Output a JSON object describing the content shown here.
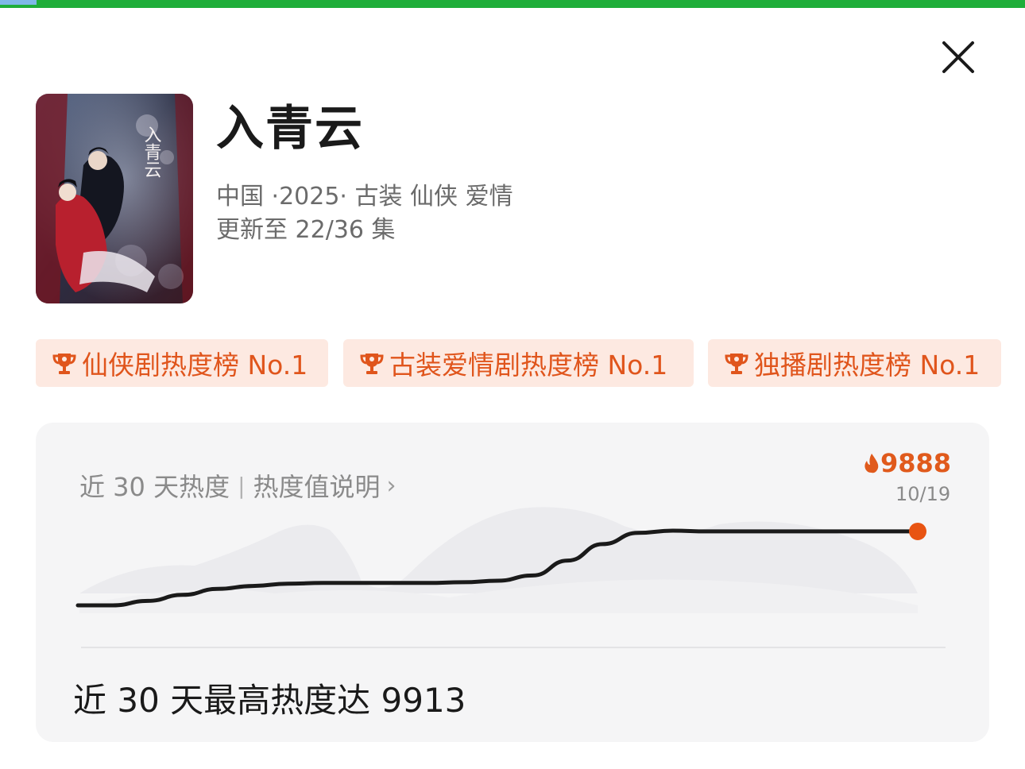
{
  "show": {
    "title": "入青云",
    "meta": "中国 ·2025· 古装 仙侠 爱情",
    "episodes": "更新至 22/36 集",
    "poster_title": "入青云"
  },
  "badges": [
    {
      "label": "仙侠剧热度榜 No.1",
      "icon": "trophy-icon"
    },
    {
      "label": "古装爱情剧热度榜 No.1",
      "icon": "trophy-icon"
    },
    {
      "label": "独播剧热度榜 No.1",
      "icon": "trophy-icon"
    }
  ],
  "heat": {
    "period_label": "近 30 天热度",
    "separator": "|",
    "explain_link": "热度值说明",
    "current_value": "9888",
    "current_date": "10/19",
    "summary": "近 30 天最高热度达 9913",
    "icons": {
      "flame": "flame-icon",
      "chevron": "chevron-right-icon",
      "close": "close-icon"
    }
  },
  "colors": {
    "accent": "#e05a1c",
    "badge_bg": "#fde9e1",
    "card_bg": "#f5f5f6",
    "line": "#1a1a1a",
    "top_bar": "#1fae3a"
  },
  "chart_data": {
    "type": "line",
    "x_range": "近 30 天",
    "end_label": "10/19",
    "end_value": 9888,
    "max_value": 9913,
    "y_relative": [
      0.0,
      0.0,
      0.06,
      0.14,
      0.22,
      0.26,
      0.29,
      0.3,
      0.3,
      0.3,
      0.3,
      0.31,
      0.33,
      0.4,
      0.6,
      0.82,
      0.97,
      1.0,
      0.99,
      0.99,
      0.99,
      0.99,
      0.99,
      0.99,
      0.99
    ]
  }
}
